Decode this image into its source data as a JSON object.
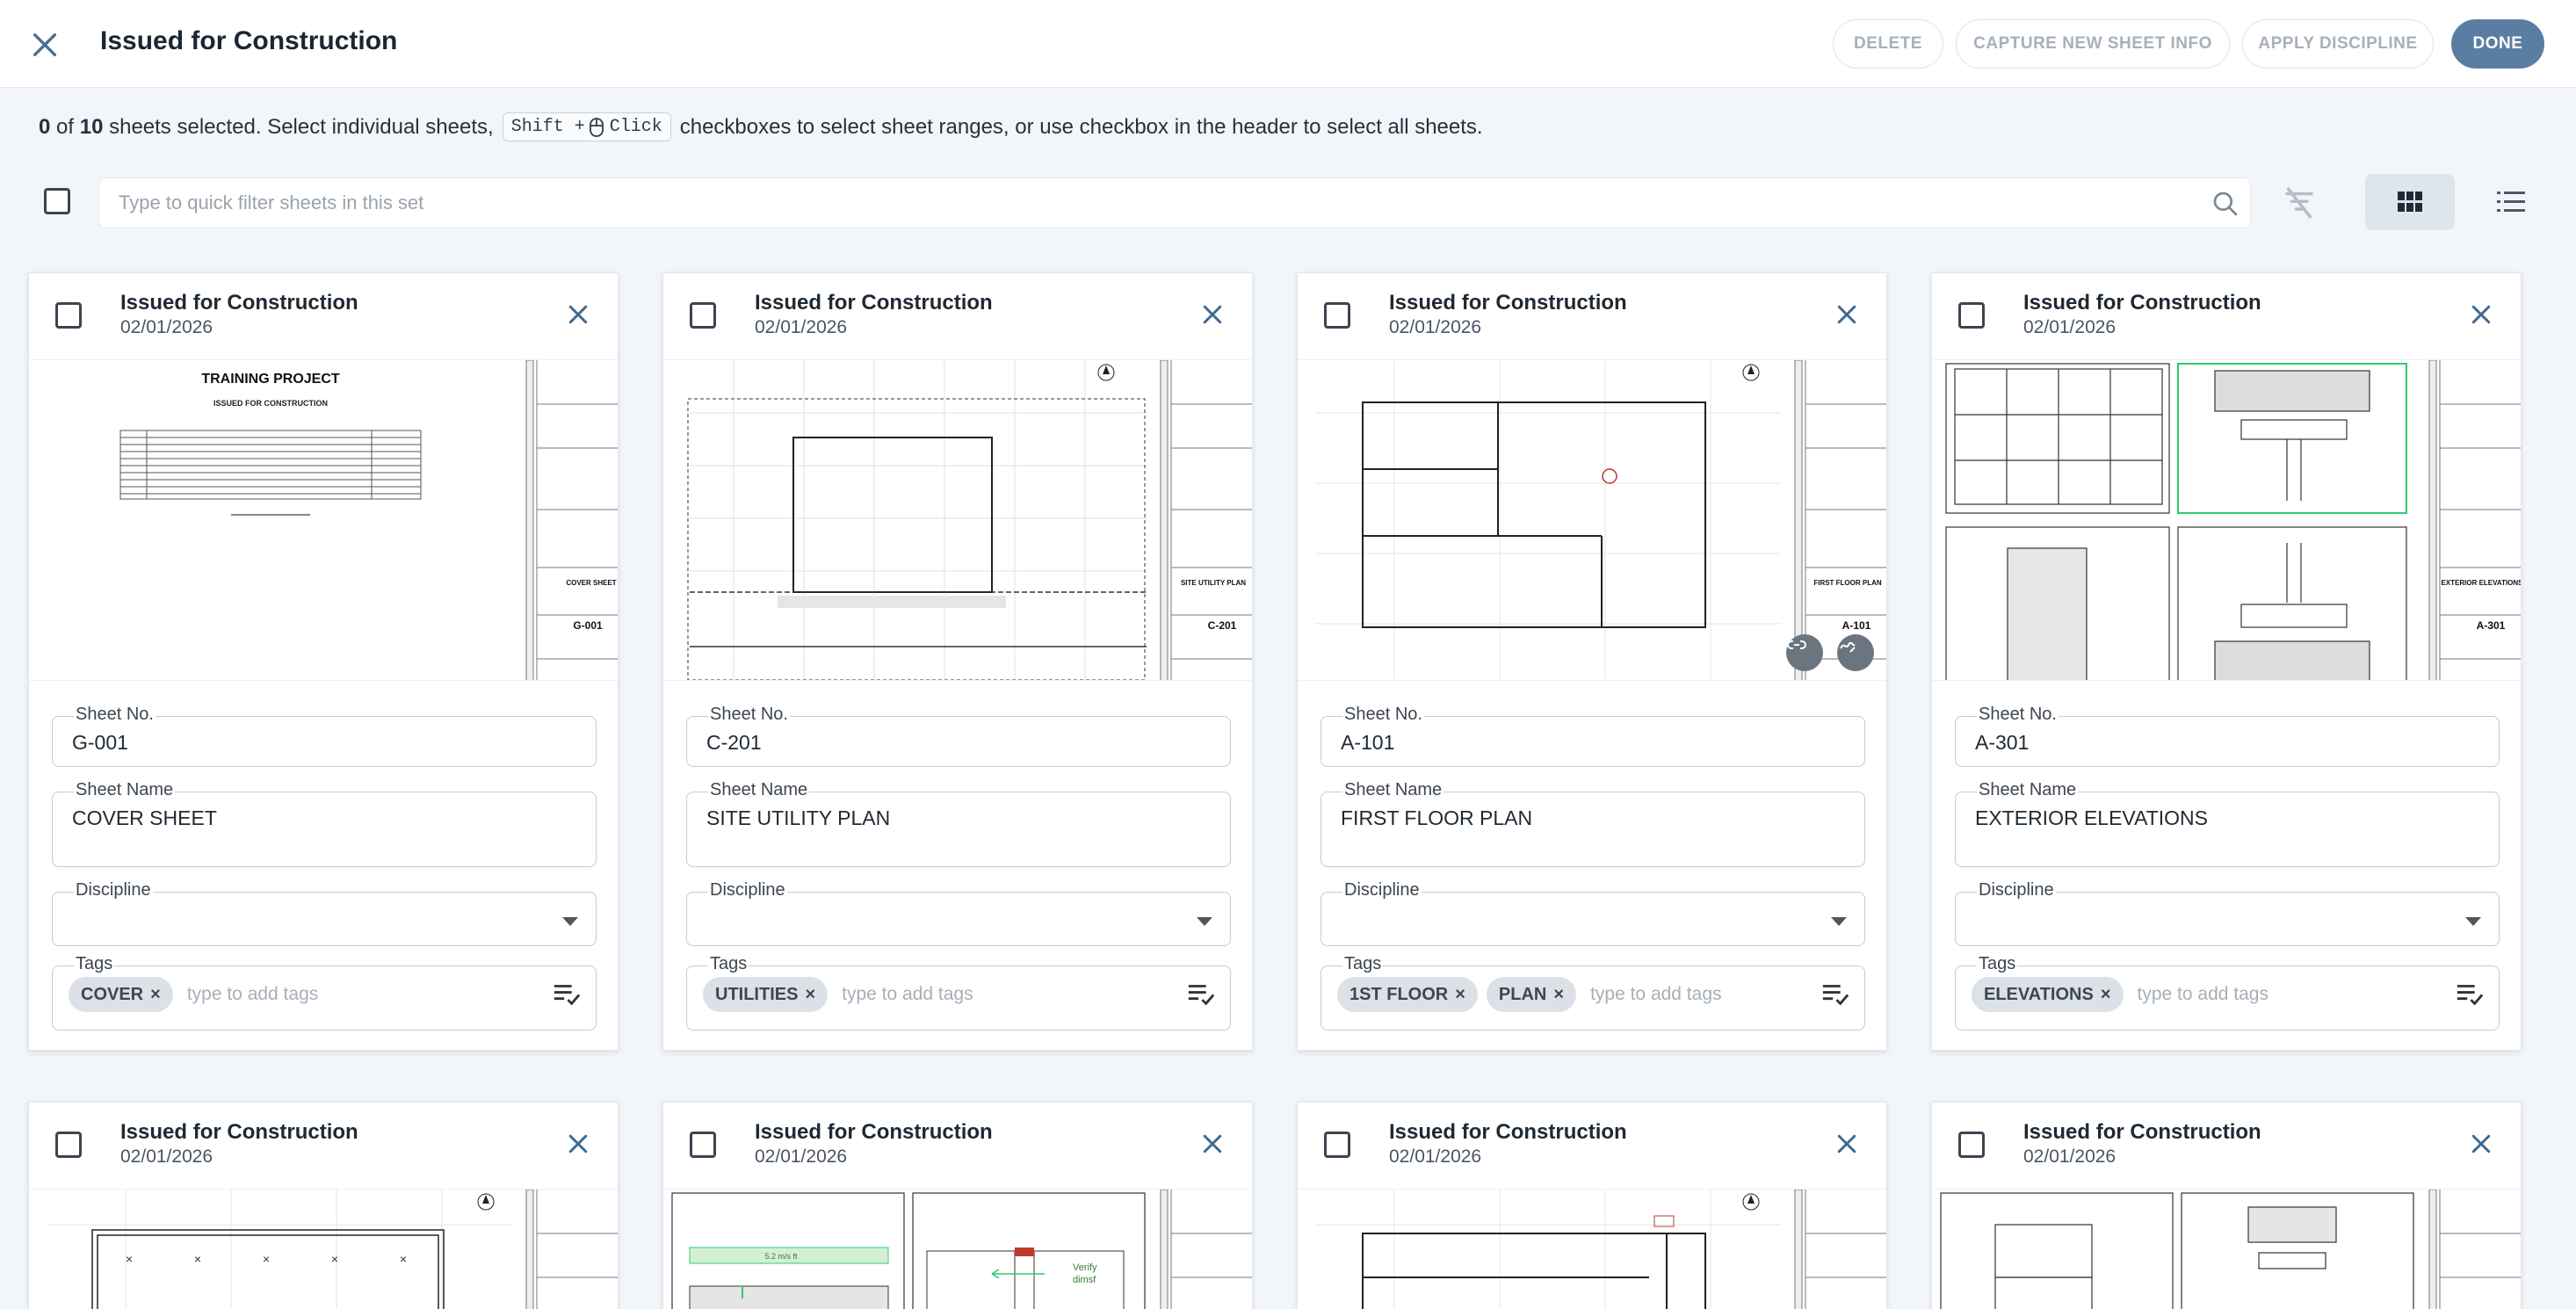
{
  "header": {
    "title": "Issued for Construction",
    "buttons": {
      "delete": "DELETE",
      "capture": "CAPTURE NEW SHEET INFO",
      "apply_discipline": "APPLY DISCIPLINE",
      "done": "DONE"
    }
  },
  "selection": {
    "count": "0",
    "of": "of",
    "total": "10",
    "text_a": "sheets selected. Select individual sheets,",
    "kbd_shift": "Shift +",
    "kbd_click": "Click",
    "text_b": "checkboxes to select sheet ranges, or use checkbox in the header to select all sheets."
  },
  "filter": {
    "placeholder": "Type to quick filter sheets in this set"
  },
  "labels": {
    "sheet_no": "Sheet No.",
    "sheet_name": "Sheet Name",
    "discipline": "Discipline",
    "tags": "Tags",
    "tag_placeholder": "type to add tags",
    "tag_remove": "×"
  },
  "cards": [
    {
      "set_name": "Issued for Construction",
      "date": "02/01/2026",
      "sheet_no": "G-001",
      "sheet_name": "COVER SHEET",
      "discipline": "",
      "tags": [
        "COVER"
      ],
      "thumb": {
        "project": "TRAINING PROJECT",
        "subtitle": "ISSUED FOR CONSTRUCTION",
        "tb_name": "COVER SHEET",
        "tb_no": "G-001"
      }
    },
    {
      "set_name": "Issued for Construction",
      "date": "02/01/2026",
      "sheet_no": "C-201",
      "sheet_name": "SITE UTILITY PLAN",
      "discipline": "",
      "tags": [
        "UTILITIES"
      ],
      "thumb": {
        "tb_name": "SITE UTILITY PLAN",
        "tb_no": "C-201"
      }
    },
    {
      "set_name": "Issued for Construction",
      "date": "02/01/2026",
      "sheet_no": "A-101",
      "sheet_name": "FIRST FLOOR PLAN",
      "discipline": "",
      "tags": [
        "1ST FLOOR",
        "PLAN"
      ],
      "thumb": {
        "tb_name": "FIRST FLOOR PLAN",
        "tb_no": "A-101"
      }
    },
    {
      "set_name": "Issued for Construction",
      "date": "02/01/2026",
      "sheet_no": "A-301",
      "sheet_name": "EXTERIOR ELEVATIONS",
      "discipline": "",
      "tags": [
        "ELEVATIONS"
      ],
      "thumb": {
        "tb_name": "EXTERIOR ELEVATIONS",
        "tb_no": "A-301"
      }
    },
    {
      "set_name": "Issued for Construction",
      "date": "02/01/2026"
    },
    {
      "set_name": "Issued for Construction",
      "date": "02/01/2026",
      "thumb": {
        "note_a": "5.2 m/s ft",
        "note_b": "Verify",
        "note_c": "dimsf"
      }
    },
    {
      "set_name": "Issued for Construction",
      "date": "02/01/2026"
    },
    {
      "set_name": "Issued for Construction",
      "date": "02/01/2026"
    }
  ]
}
